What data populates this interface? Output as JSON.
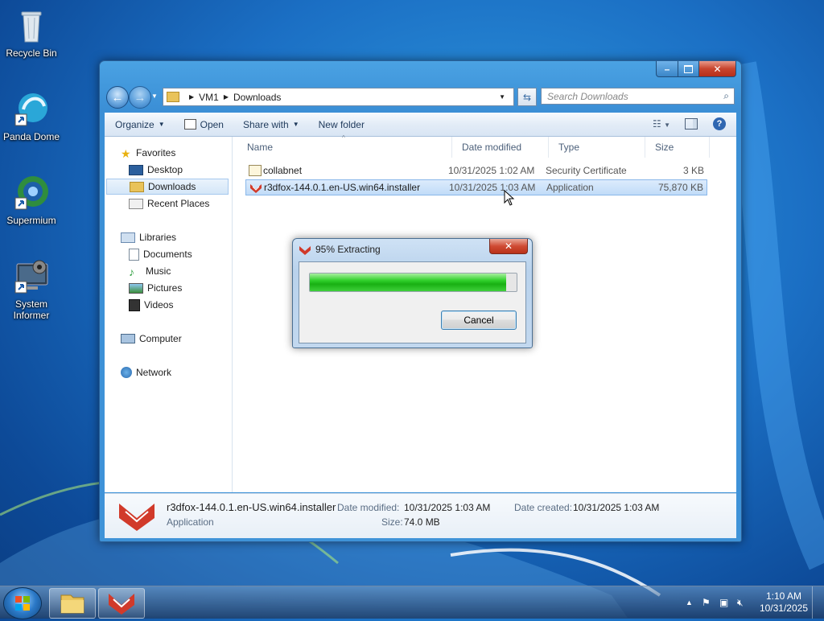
{
  "desktop": {
    "icons": [
      {
        "label": "Recycle Bin",
        "icon": "recycle-bin-icon"
      },
      {
        "label": "Panda Dome",
        "icon": "panda-dome-icon"
      },
      {
        "label": "Supermium",
        "icon": "supermium-icon"
      },
      {
        "label": "System Informer",
        "icon": "system-informer-icon"
      }
    ]
  },
  "explorer": {
    "address": {
      "segments": [
        "VM1",
        "Downloads"
      ]
    },
    "search_placeholder": "Search Downloads",
    "toolbar": {
      "organize": "Organize",
      "open": "Open",
      "share_with": "Share with",
      "new_folder": "New folder"
    },
    "navpane": {
      "favorites": "Favorites",
      "desktop": "Desktop",
      "downloads": "Downloads",
      "recent_places": "Recent Places",
      "libraries": "Libraries",
      "documents": "Documents",
      "music": "Music",
      "pictures": "Pictures",
      "videos": "Videos",
      "computer": "Computer",
      "network": "Network"
    },
    "columns": {
      "name": "Name",
      "date_modified": "Date modified",
      "type": "Type",
      "size": "Size"
    },
    "files": [
      {
        "name": "collabnet",
        "date": "10/31/2025 1:02 AM",
        "type": "Security Certificate",
        "size": "3 KB"
      },
      {
        "name": "r3dfox-144.0.1.en-US.win64.installer",
        "date": "10/31/2025 1:03 AM",
        "type": "Application",
        "size": "75,870 KB"
      }
    ],
    "details": {
      "name": "r3dfox-144.0.1.en-US.win64.installer",
      "kind": "Application",
      "date_modified_label": "Date modified:",
      "date_modified": "10/31/2025 1:03 AM",
      "date_created_label": "Date created:",
      "date_created": "10/31/2025 1:03 AM",
      "size_label": "Size:",
      "size": "74.0 MB"
    }
  },
  "dialog": {
    "title": "95% Extracting",
    "progress_percent": 95,
    "cancel": "Cancel"
  },
  "taskbar": {
    "time": "1:10 AM",
    "date": "10/31/2025"
  },
  "colors": {
    "accent": "#3b8fd6",
    "progress": "#1fbf1a",
    "close": "#c8452e"
  }
}
